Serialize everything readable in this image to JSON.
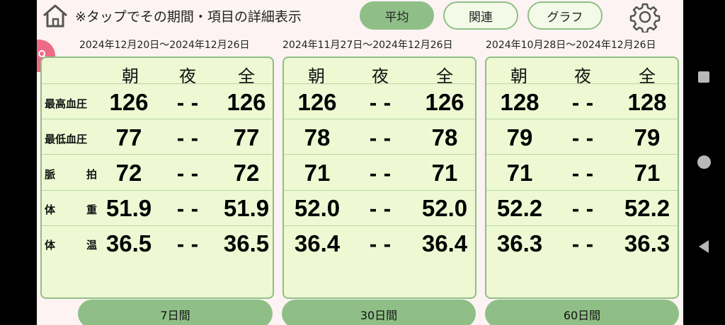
{
  "header": {
    "hint": "※タップでその期間・項目の詳細表示",
    "tabs": [
      "平均",
      "関連",
      "グラフ"
    ],
    "active_tab": "平均"
  },
  "columns": [
    "朝",
    "夜",
    "全"
  ],
  "row_labels": [
    [
      "最高血圧",
      ""
    ],
    [
      "最低血圧",
      ""
    ],
    [
      "脈",
      "拍"
    ],
    [
      "体",
      "重"
    ],
    [
      "体",
      "温"
    ]
  ],
  "panels": [
    {
      "date_range": "2024年12月20日～2024年12月26日",
      "period": "7日間",
      "rows": [
        [
          "126",
          "- -",
          "126"
        ],
        [
          "77",
          "- -",
          "77"
        ],
        [
          "72",
          "- -",
          "72"
        ],
        [
          "51.9",
          "- -",
          "51.9"
        ],
        [
          "36.5",
          "- -",
          "36.5"
        ]
      ]
    },
    {
      "date_range": "2024年11月27日～2024年12月26日",
      "period": "30日間",
      "rows": [
        [
          "126",
          "- -",
          "126"
        ],
        [
          "78",
          "- -",
          "78"
        ],
        [
          "71",
          "- -",
          "71"
        ],
        [
          "52.0",
          "- -",
          "52.0"
        ],
        [
          "36.4",
          "- -",
          "36.4"
        ]
      ]
    },
    {
      "date_range": "2024年10月28日～2024年12月26日",
      "period": "60日間",
      "rows": [
        [
          "128",
          "- -",
          "128"
        ],
        [
          "79",
          "- -",
          "79"
        ],
        [
          "71",
          "- -",
          "71"
        ],
        [
          "52.2",
          "- -",
          "52.2"
        ],
        [
          "36.3",
          "- -",
          "36.3"
        ]
      ]
    }
  ],
  "colors": {
    "accent_green": "#8fbf86",
    "panel_bg": "#eef8d2",
    "page_bg": "#fdf3f3",
    "pink": "#ee6b87"
  },
  "icons": {
    "home": "home-icon",
    "settings": "gear-icon",
    "side_tab": "magnifier-icon"
  }
}
